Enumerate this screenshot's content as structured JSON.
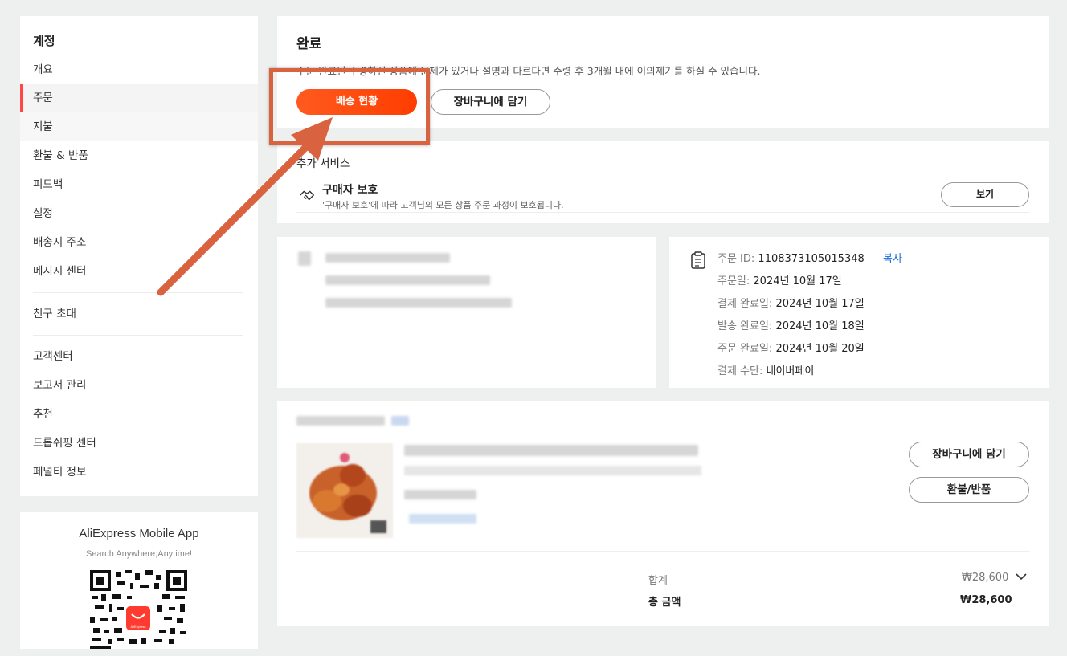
{
  "sidebar": {
    "title": "계정",
    "items": [
      {
        "label": "개요"
      },
      {
        "label": "주문"
      },
      {
        "label": "지불"
      },
      {
        "label": "환불 & 반품"
      },
      {
        "label": "피드백"
      },
      {
        "label": "설정"
      },
      {
        "label": "배송지 주소"
      },
      {
        "label": "메시지 센터"
      },
      {
        "label": "친구 초대"
      },
      {
        "label": "고객센터"
      },
      {
        "label": "보고서 관리"
      },
      {
        "label": "추천"
      },
      {
        "label": "드롭쉬핑 센터"
      },
      {
        "label": "페널티 정보"
      }
    ],
    "active_item": "주문"
  },
  "app_promo": {
    "title": "AliExpress Mobile App",
    "subtitle": "Search Anywhere,Anytime!",
    "qr_logo_text": "AliExpress"
  },
  "status": {
    "title": "완료",
    "description": "주문 완료된 수령하신 상품에 문제가 있거나 설명과 다르다면 수령 후 3개월 내에 이의제기를 하실 수 있습니다.",
    "track_button": "배송 현황",
    "cart_button": "장바구니에 담기"
  },
  "services": {
    "title": "추가 서비스",
    "buyer_protection_title": "구매자 보호",
    "buyer_protection_desc": "'구매자 보호'에 따라 고객님의 모든 상품 주문 과정이 보호됩니다.",
    "view_button": "보기"
  },
  "order_info": {
    "order_id_label": "주문 ID:",
    "order_id": "1108373105015348",
    "copy_label": "복사",
    "order_date_label": "주문일:",
    "order_date": "2024년 10월 17일",
    "payment_done_label": "결제 완료일:",
    "payment_done": "2024년 10월 17일",
    "shipped_label": "발송 완료일:",
    "shipped": "2024년 10월 18일",
    "completed_label": "주문 완료일:",
    "completed": "2024년 10월 20일",
    "payment_method_label": "결제 수단:",
    "payment_method": "네이버페이"
  },
  "item": {
    "add_to_cart_button": "장바구니에 담기",
    "refund_button": "환불/반품",
    "subtotal_label": "합계",
    "subtotal_value": "₩28,600",
    "total_label": "총 금액",
    "total_value": "₩28,600"
  },
  "colors": {
    "accent": "#ff4747",
    "track_button": "#ff5a1f",
    "annotation": "#d9623f",
    "link": "#1a6fd6"
  }
}
